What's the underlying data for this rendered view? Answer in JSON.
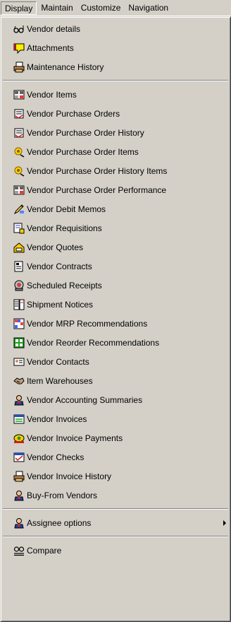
{
  "menubar": {
    "items": [
      {
        "label": "Display"
      },
      {
        "label": "Maintain"
      },
      {
        "label": "Customize"
      },
      {
        "label": "Navigation"
      }
    ]
  },
  "menu": {
    "group1": [
      {
        "label": "Vendor details",
        "icon": "glasses-icon"
      },
      {
        "label": "Attachments",
        "icon": "attachment-note-icon"
      },
      {
        "label": "Maintenance History",
        "icon": "history-printer-icon"
      }
    ],
    "group2": [
      {
        "label": "Vendor Items",
        "icon": "items-catalog-icon"
      },
      {
        "label": "Vendor Purchase Orders",
        "icon": "purchase-orders-icon"
      },
      {
        "label": "Vendor Purchase Order History",
        "icon": "purchase-order-history-icon"
      },
      {
        "label": "Vendor Purchase Order Items",
        "icon": "purchase-order-items-icon"
      },
      {
        "label": "Vendor Purchase Order History Items",
        "icon": "purchase-order-history-items-icon"
      },
      {
        "label": "Vendor Purchase Order Performance",
        "icon": "performance-catalog-icon"
      },
      {
        "label": "Vendor Debit Memos",
        "icon": "pencil-memo-icon"
      },
      {
        "label": "Vendor Requisitions",
        "icon": "requisitions-icon"
      },
      {
        "label": "Vendor Quotes",
        "icon": "quotes-icon"
      },
      {
        "label": "Vendor Contracts",
        "icon": "contract-document-icon"
      },
      {
        "label": "Scheduled Receipts",
        "icon": "scheduled-receipts-icon"
      },
      {
        "label": "Shipment Notices",
        "icon": "shipment-notices-icon"
      },
      {
        "label": "Vendor MRP Recommendations",
        "icon": "mrp-grid-icon"
      },
      {
        "label": "Vendor Reorder Recommendations",
        "icon": "reorder-grid-icon"
      },
      {
        "label": "Vendor Contacts",
        "icon": "contact-card-icon"
      },
      {
        "label": "Item Warehouses",
        "icon": "handshake-icon"
      },
      {
        "label": "Vendor Accounting Summaries",
        "icon": "person-icon"
      },
      {
        "label": "Vendor Invoices",
        "icon": "invoice-icon"
      },
      {
        "label": "Vendor Invoice Payments",
        "icon": "invoice-payment-icon"
      },
      {
        "label": "Vendor Checks",
        "icon": "check-window-icon"
      },
      {
        "label": "Vendor Invoice History",
        "icon": "invoice-history-printer-icon"
      },
      {
        "label": "Buy-From Vendors",
        "icon": "person-icon"
      }
    ],
    "group3": [
      {
        "label": "Assignee options",
        "icon": "person-icon",
        "has_submenu": true
      }
    ],
    "group4": [
      {
        "label": "Compare",
        "icon": "compare-icon"
      }
    ]
  },
  "colors": {
    "menu_bg": "#d4d0c8",
    "highlight": "#ffffff",
    "shadow": "#808080",
    "dark_shadow": "#404040"
  }
}
